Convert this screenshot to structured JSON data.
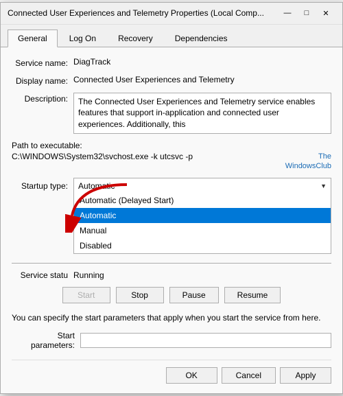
{
  "window": {
    "title": "Connected User Experiences and Telemetry Properties (Local Comp...",
    "close_btn": "✕",
    "minimize_btn": "—",
    "maximize_btn": "□"
  },
  "tabs": [
    {
      "id": "general",
      "label": "General",
      "active": true
    },
    {
      "id": "logon",
      "label": "Log On",
      "active": false
    },
    {
      "id": "recovery",
      "label": "Recovery",
      "active": false
    },
    {
      "id": "dependencies",
      "label": "Dependencies",
      "active": false
    }
  ],
  "fields": {
    "service_name_label": "Service name:",
    "service_name_value": "DiagTrack",
    "display_name_label": "Display name:",
    "display_name_value": "Connected User Experiences and Telemetry",
    "description_label": "Description:",
    "description_value": "The Connected User Experiences and Telemetry service enables features that support in-application and connected user experiences. Additionally, this",
    "path_label": "Path to executable:",
    "path_value": "C:\\WINDOWS\\System32\\svchost.exe -k utcsvc -p",
    "watermark": "The\nWindowsClub",
    "startup_type_label": "Startup type:",
    "startup_type_value": "Automatic",
    "dropdown_options": [
      {
        "value": "automatic_delayed",
        "label": "Automatic (Delayed Start)",
        "selected": false
      },
      {
        "value": "automatic",
        "label": "Automatic",
        "selected": true
      },
      {
        "value": "manual",
        "label": "Manual",
        "selected": false
      },
      {
        "value": "disabled",
        "label": "Disabled",
        "selected": false
      }
    ],
    "service_status_label": "Service statu",
    "service_status_value": "Running",
    "start_btn": "Start",
    "stop_btn": "Stop",
    "pause_btn": "Pause",
    "resume_btn": "Resume",
    "info_text": "You can specify the start parameters that apply when you start the service from here.",
    "start_params_label": "Start parameters:",
    "start_params_placeholder": "",
    "ok_btn": "OK",
    "cancel_btn": "Cancel",
    "apply_btn": "Apply"
  }
}
